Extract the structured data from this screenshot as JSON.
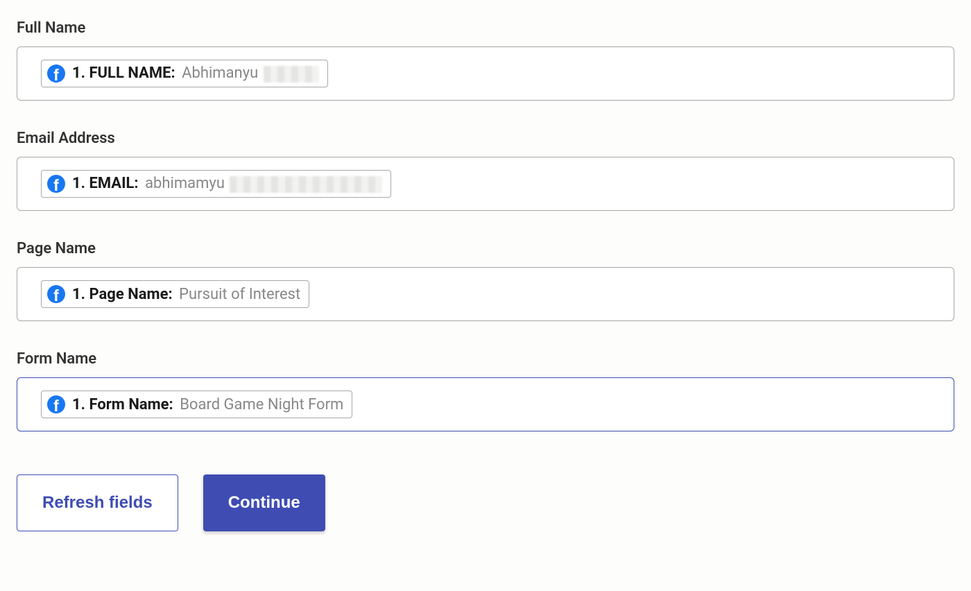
{
  "fields": [
    {
      "id": "full-name",
      "label": "Full Name",
      "pill_key": "1. FULL NAME:",
      "pill_value": "Abhimanyu",
      "blurred": "small",
      "active": false
    },
    {
      "id": "email",
      "label": "Email Address",
      "pill_key": "1. EMAIL:",
      "pill_value": "abhimamyu",
      "blurred": "wide",
      "active": false
    },
    {
      "id": "page-name",
      "label": "Page Name",
      "pill_key": "1. Page Name:",
      "pill_value": "Pursuit of Interest",
      "blurred": "none",
      "active": false
    },
    {
      "id": "form-name",
      "label": "Form Name",
      "pill_key": "1. Form Name:",
      "pill_value": "Board Game Night Form",
      "blurred": "none",
      "active": true
    }
  ],
  "buttons": {
    "refresh": "Refresh fields",
    "continue": "Continue"
  }
}
